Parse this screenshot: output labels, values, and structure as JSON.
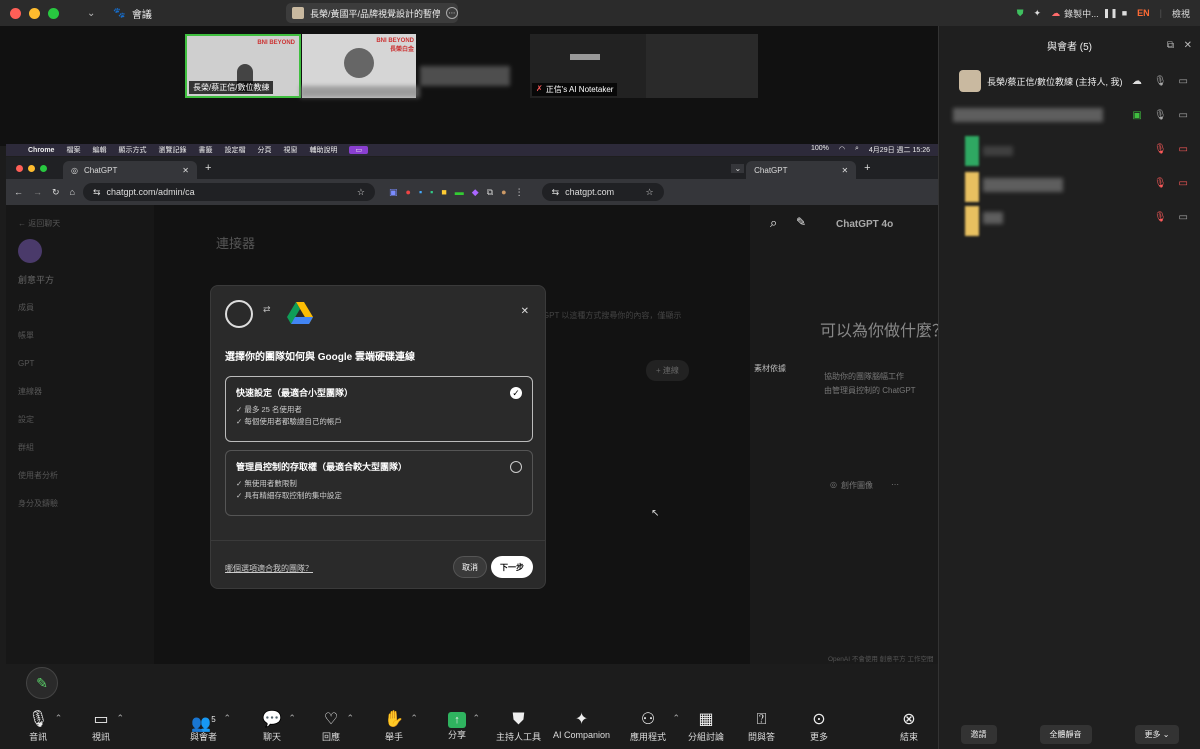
{
  "window": {
    "meeting_label": "會議",
    "share_title": "長榮/黃國平/品牌視覺設計的暫停..."
  },
  "topbar_right": {
    "recording": "錄製中...",
    "lang": "EN",
    "view": "檢視"
  },
  "thumbnails": [
    {
      "label": "長榮/蔡正信/數位教練",
      "brand": "BNI BEYOND"
    },
    {
      "label": "",
      "brand": "BNI BEYOND 長榮白金"
    },
    {
      "label": "正信's AI Notetaker"
    }
  ],
  "mac_menu": [
    "Chrome",
    "檔案",
    "編輯",
    "顯示方式",
    "瀏覽記錄",
    "書籤",
    "設定檔",
    "分頁",
    "視窗",
    "輔助說明"
  ],
  "mac_status": {
    "battery": "100%",
    "date": "4月29日 週二 15:26"
  },
  "browser": {
    "tab_left": "ChatGPT",
    "url_left": "chatgpt.com/admin/ca",
    "tab_right": "ChatGPT",
    "url_right": "chatgpt.com"
  },
  "sidebar": {
    "back": "← 返回聊天",
    "workspace": "創意平方",
    "items": [
      "成員",
      "帳單",
      "GPT",
      "連線器",
      "設定",
      "群組",
      "使用者分析",
      "身分及鑄驗"
    ]
  },
  "page": {
    "heading": "連接器",
    "desc": "ChatGPT 以這種方式搜尋你的內容，僅顯示",
    "connect_btn": "+ 連線"
  },
  "right_pane": {
    "model": "ChatGPT 4o",
    "hero": "可以為你做什麼？",
    "line1": "協助你的團隊腦幅工作",
    "line2": "由管理員控制的 ChatGPT",
    "side_item": "素材依據",
    "create_image": "創作圖像",
    "footer": "OpenAI 不會使用 創意平方 工作空間"
  },
  "modal": {
    "title": "選擇你的團隊如何與 Google 雲端硬碟連線",
    "option1": {
      "title": "快速設定（最適合小型團隊）",
      "lines": [
        "最多 25 名使用者",
        "每個使用者都驗證自己的帳戶"
      ]
    },
    "option2": {
      "title": "管理員控制的存取權（最適合較大型團隊）",
      "lines": [
        "無使用者數限制",
        "具有精細存取控制的集中設定"
      ]
    },
    "help_link": "哪個選項適合我的團隊？",
    "cancel": "取消",
    "next": "下一步"
  },
  "participants": {
    "title": "與會者 (5)",
    "host": "長榮/蔡正信/數位教練 (主持人, 我)",
    "invite": "邀請",
    "mute_all": "全體靜音",
    "more": "更多"
  },
  "controls": [
    {
      "label": "音訊",
      "icon": "mic-icon"
    },
    {
      "label": "視訊",
      "icon": "video-icon"
    },
    {
      "label": "與會者",
      "icon": "participants-icon",
      "count": "5"
    },
    {
      "label": "聊天",
      "icon": "chat-icon"
    },
    {
      "label": "回應",
      "icon": "heart-icon"
    },
    {
      "label": "舉手",
      "icon": "hand-icon"
    },
    {
      "label": "分享",
      "icon": "share-icon"
    },
    {
      "label": "主持人工具",
      "icon": "shield-icon"
    },
    {
      "label": "AI Companion",
      "icon": "sparkle-icon"
    },
    {
      "label": "應用程式",
      "icon": "apps-icon"
    },
    {
      "label": "分組討論",
      "icon": "grid-icon"
    },
    {
      "label": "問與答",
      "icon": "qa-icon"
    },
    {
      "label": "更多",
      "icon": "more-icon"
    },
    {
      "label": "結束",
      "icon": "end-icon"
    }
  ]
}
